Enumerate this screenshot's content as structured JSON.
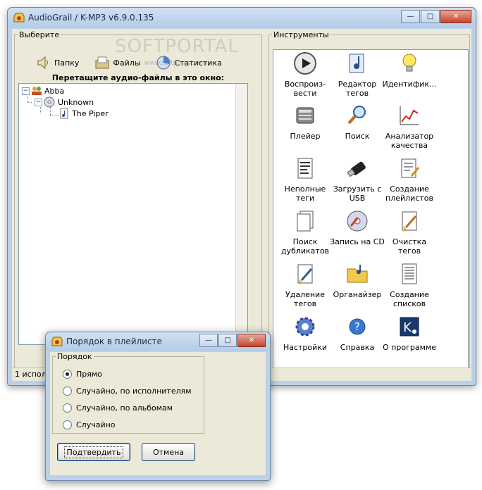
{
  "main_window": {
    "title": "AudioGrail / K-MP3 v6.9.0.135",
    "status_text": "1 испол"
  },
  "select_group": {
    "legend": "Выберите",
    "buttons": [
      {
        "label": "Папку",
        "icon": "speaker-icon"
      },
      {
        "label": "Файлы",
        "icon": "files-icon"
      },
      {
        "label": "Статистика",
        "icon": "stats-icon"
      }
    ],
    "drop_hint": "Перетащите аудио-файлы в это окно:"
  },
  "tree": {
    "artist": "Abba",
    "album": "Unknown",
    "track": "The Piper"
  },
  "tools_group": {
    "legend": "Инструменты",
    "tools": [
      {
        "label": "Воспроиз-\nвести",
        "icon": "play-icon"
      },
      {
        "label": "Редактор\nтегов",
        "icon": "music-note-icon"
      },
      {
        "label": "Идентифик...",
        "icon": "lightbulb-icon"
      },
      {
        "label": "Плейер",
        "icon": "player-icon"
      },
      {
        "label": "Поиск",
        "icon": "magnifier-icon"
      },
      {
        "label": "Анализатор\nкачества",
        "icon": "chart-icon"
      },
      {
        "label": "Неполные\nтеги",
        "icon": "document-icon"
      },
      {
        "label": "Загрузить с\nUSB",
        "icon": "usb-icon"
      },
      {
        "label": "Создание\nплейлистов",
        "icon": "playlist-edit-icon"
      },
      {
        "label": "Поиск\nдубликатов",
        "icon": "duplicates-icon"
      },
      {
        "label": "Запись на CD",
        "icon": "cd-icon"
      },
      {
        "label": "Очистка\nтегов",
        "icon": "broom-icon"
      },
      {
        "label": "Удаление\nтегов",
        "icon": "broom-delete-icon"
      },
      {
        "label": "Органайзер",
        "icon": "folder-icon"
      },
      {
        "label": "Создание\nсписков",
        "icon": "list-icon"
      },
      {
        "label": "Настройки",
        "icon": "gear-icon"
      },
      {
        "label": "Справка",
        "icon": "help-icon"
      },
      {
        "label": "О программе",
        "icon": "about-icon"
      }
    ]
  },
  "dialog": {
    "title": "Порядок в плейлисте",
    "group_legend": "Порядок",
    "options": [
      {
        "label": "Прямо",
        "checked": true
      },
      {
        "label": "Случайно, по исполнителям",
        "checked": false
      },
      {
        "label": "Случайно, по альбомам",
        "checked": false
      },
      {
        "label": "Случайно",
        "checked": false
      }
    ],
    "confirm_label": "Подтвердить",
    "cancel_label": "Отмена"
  },
  "watermark": {
    "main": "SOFTPORTAL",
    "sub": "www.softportal.com"
  }
}
